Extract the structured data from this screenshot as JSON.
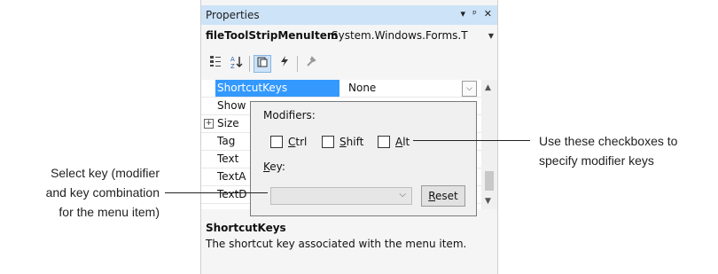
{
  "window": {
    "title": "Properties",
    "pin_icon": "pin-icon",
    "close_icon": "close-icon",
    "dropdown_icon": "chevron-down-icon"
  },
  "object_selector": {
    "name": "fileToolStripMenuItem",
    "type": "System.Windows.Forms.T"
  },
  "toolbar": {
    "buttons": [
      "categorized-icon",
      "alphabetical-icon",
      "properties-icon",
      "events-icon",
      "property-pages-icon"
    ]
  },
  "grid": {
    "rows": [
      {
        "name": "ShortcutKeys",
        "value": "None",
        "selected": true
      },
      {
        "name": "Show"
      },
      {
        "name": "Size",
        "expandable": true
      },
      {
        "name": "Tag"
      },
      {
        "name": "Text"
      },
      {
        "name": "TextA"
      },
      {
        "name": "TextD"
      }
    ],
    "expand_glyph": "+"
  },
  "popup": {
    "modifiers_label": "Modifiers:",
    "ctrl": {
      "accel": "C",
      "rest": "trl"
    },
    "shift": {
      "accel": "S",
      "rest": "hift"
    },
    "alt": {
      "accel": "A",
      "rest": "lt"
    },
    "key_label": {
      "accel": "K",
      "rest": "ey:"
    },
    "key_value": "",
    "reset": {
      "accel": "R",
      "rest": "eset"
    }
  },
  "description": {
    "title": "ShortcutKeys",
    "text": "The shortcut key associated with the menu item."
  },
  "callouts": {
    "left": [
      "Select key (modifier",
      "and key combination",
      "for the menu item)"
    ],
    "right": [
      "Use these checkboxes to",
      "specify modifier keys"
    ]
  },
  "colors": {
    "accent": "#3399ff",
    "titlebar": "#cde3f7"
  }
}
